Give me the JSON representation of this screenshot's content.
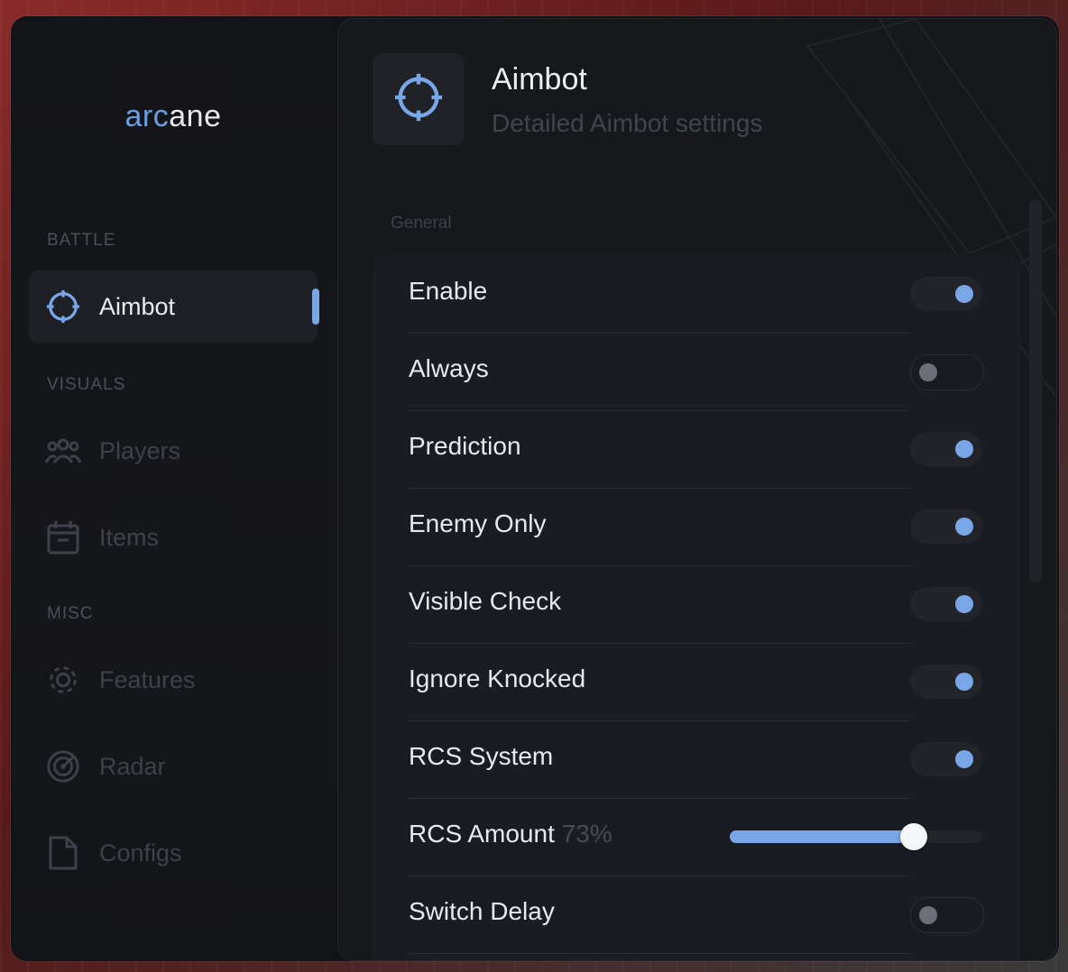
{
  "brand": {
    "part1": "arc",
    "part2": "ane"
  },
  "sidebar": {
    "sections": [
      {
        "label": "BATTLE"
      },
      {
        "label": "VISUALS"
      },
      {
        "label": "MISC"
      }
    ],
    "items": [
      {
        "label": "Aimbot",
        "icon": "crosshair-icon",
        "active": true
      },
      {
        "label": "Players",
        "icon": "players-icon",
        "active": false
      },
      {
        "label": "Items",
        "icon": "box-icon",
        "active": false
      },
      {
        "label": "Features",
        "icon": "gear-icon",
        "active": false
      },
      {
        "label": "Radar",
        "icon": "radar-icon",
        "active": false
      },
      {
        "label": "Configs",
        "icon": "file-icon",
        "active": false
      }
    ]
  },
  "header": {
    "title": "Aimbot",
    "subtitle": "Detailed Aimbot settings",
    "icon": "crosshair-icon"
  },
  "group": {
    "label": "General"
  },
  "settings": [
    {
      "label": "Enable",
      "type": "toggle",
      "on": true
    },
    {
      "label": "Always",
      "type": "toggle",
      "on": false
    },
    {
      "label": "Prediction",
      "type": "toggle",
      "on": true
    },
    {
      "label": "Enemy Only",
      "type": "toggle",
      "on": true
    },
    {
      "label": "Visible Check",
      "type": "toggle",
      "on": true
    },
    {
      "label": "Ignore Knocked",
      "type": "toggle",
      "on": true
    },
    {
      "label": "RCS System",
      "type": "toggle",
      "on": true
    },
    {
      "label": "RCS Amount",
      "type": "slider",
      "value_text": "73%",
      "value": 0.73
    },
    {
      "label": "Switch Delay",
      "type": "toggle",
      "on": false
    }
  ],
  "colors": {
    "accent": "#79a6e6",
    "background": "#121316",
    "panel": "#17181c"
  }
}
